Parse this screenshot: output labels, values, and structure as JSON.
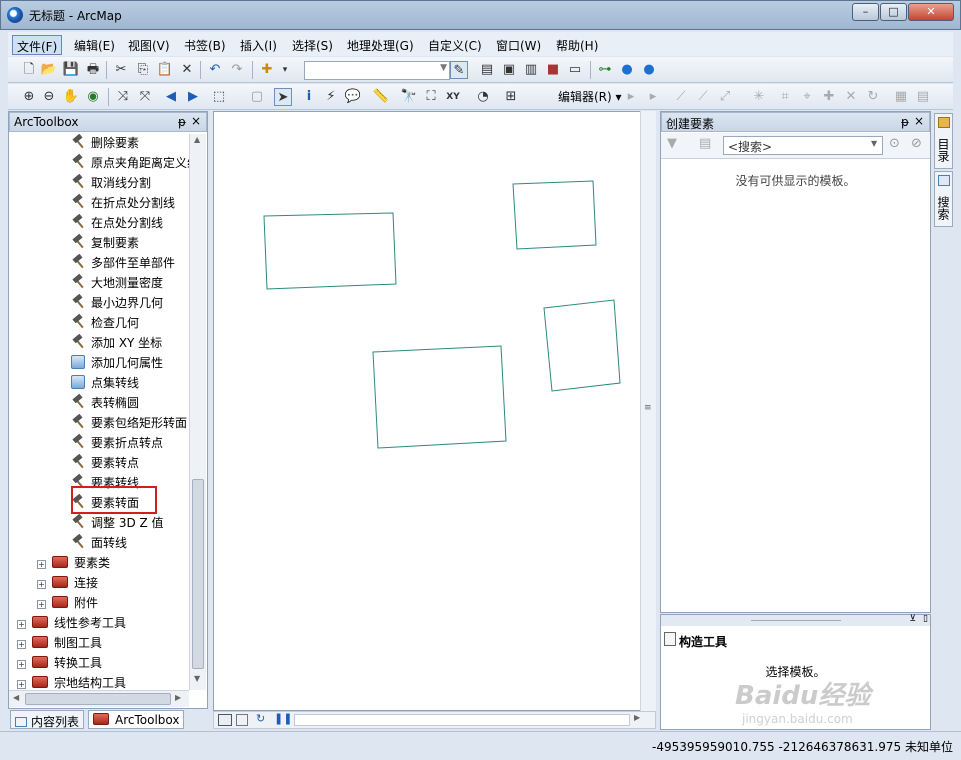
{
  "window": {
    "title": "无标题 - ArcMap",
    "minimize_glyph": "–",
    "maximize_glyph": "□",
    "close_glyph": "✕"
  },
  "menubar": [
    "文件(F)",
    "编辑(E)",
    "视图(V)",
    "书签(B)",
    "插入(I)",
    "选择(S)",
    "地理处理(G)",
    "自定义(C)",
    "窗口(W)",
    "帮助(H)"
  ],
  "toolbar": {
    "editor_label": "编辑器(R) ▾",
    "identify_icon": "i",
    "xy_icon": "XY"
  },
  "toolbox": {
    "title": "ArcToolbox",
    "pin": "ᵽ",
    "close": "×",
    "tools": [
      "删除要素",
      "原点夹角距离定义线",
      "取消线分割",
      "在折点处分割线",
      "在点处分割线",
      "复制要素",
      "多部件至单部件",
      "大地测量密度",
      "最小边界几何",
      "检查几何",
      "添加 XY 坐标",
      "添加几何属性",
      "点集转线",
      "表转椭圆",
      "要素包络矩形转面",
      "要素折点转点",
      "要素转点",
      "要素转线",
      "要素转面",
      "调整 3D Z 值",
      "面转线"
    ],
    "script_tools": [
      "添加几何属性",
      "点集转线"
    ],
    "toolsets": [
      "要素类",
      "连接",
      "附件"
    ],
    "toolboxes": [
      "线性参考工具",
      "制图工具",
      "转换工具",
      "宗地结构工具"
    ]
  },
  "tabs": {
    "toc": "内容列表",
    "arctoolbox": "ArcToolbox"
  },
  "create_features": {
    "title": "创建要素",
    "search_placeholder": "<搜索>",
    "empty_message": "没有可供显示的模板。"
  },
  "construct_tools": {
    "title": "构造工具",
    "message": "选择模板。"
  },
  "right_tabs": [
    "目录",
    "搜索"
  ],
  "status": {
    "coordinates": "-495395959010.755  -212646378631.975 未知单位"
  },
  "watermark": {
    "main": "Baidu经验",
    "sub": "jingyan.baidu.com"
  },
  "colors": {
    "polygon_stroke": "#2a8a7e",
    "highlight": "#d11f1f"
  }
}
